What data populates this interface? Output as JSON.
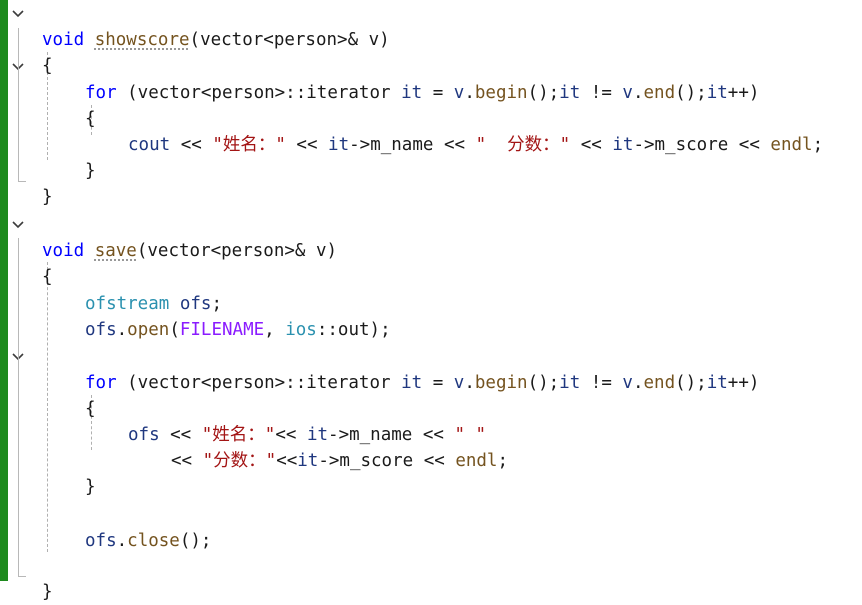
{
  "editor": {
    "language": "C++",
    "colors": {
      "keyword": "#0000ff",
      "type": "#2b91af",
      "function": "#74531f",
      "string": "#a31515",
      "macro": "#8a1bff",
      "change_bar": "#1e8a1e"
    },
    "lines": [
      [
        "void",
        " ",
        "showscore",
        "(vector<person>& v)"
      ],
      [
        "{"
      ],
      [
        "for",
        " (vector<person>::iterator ",
        "it",
        " = ",
        "v",
        ".",
        "begin",
        "();",
        "it",
        " != ",
        "v",
        ".",
        "end",
        "();",
        "it",
        "++)"
      ],
      [
        "{"
      ],
      [
        "cout",
        " << ",
        "\"姓名：\"",
        " << ",
        "it",
        "->m_name << ",
        "\"  分数：\"",
        " << ",
        "it",
        "->m_score << ",
        "endl",
        ";"
      ],
      [
        "}"
      ],
      [
        "}"
      ],
      [
        "void",
        " ",
        "save",
        "(vector<person>& v)"
      ],
      [
        "{"
      ],
      [
        "ofstream",
        " ",
        "ofs",
        ";"
      ],
      [
        "ofs",
        ".",
        "open",
        "(",
        "FILENAME",
        ", ",
        "ios",
        "::",
        "out",
        ");"
      ],
      [
        "for",
        " (vector<person>::iterator ",
        "it",
        " = ",
        "v",
        ".",
        "begin",
        "();",
        "it",
        " != ",
        "v",
        ".",
        "end",
        "();",
        "it",
        "++)"
      ],
      [
        "{"
      ],
      [
        "ofs",
        " << ",
        "\"姓名：\"",
        "<< ",
        "it",
        "->m_name << ",
        "\" \""
      ],
      [
        "<< ",
        "\"分数：\"",
        "<<",
        "it",
        "->m_score << ",
        "endl",
        ";"
      ],
      [
        "}"
      ],
      [
        "ofs",
        ".",
        "close",
        "();"
      ],
      [
        "}"
      ]
    ]
  }
}
